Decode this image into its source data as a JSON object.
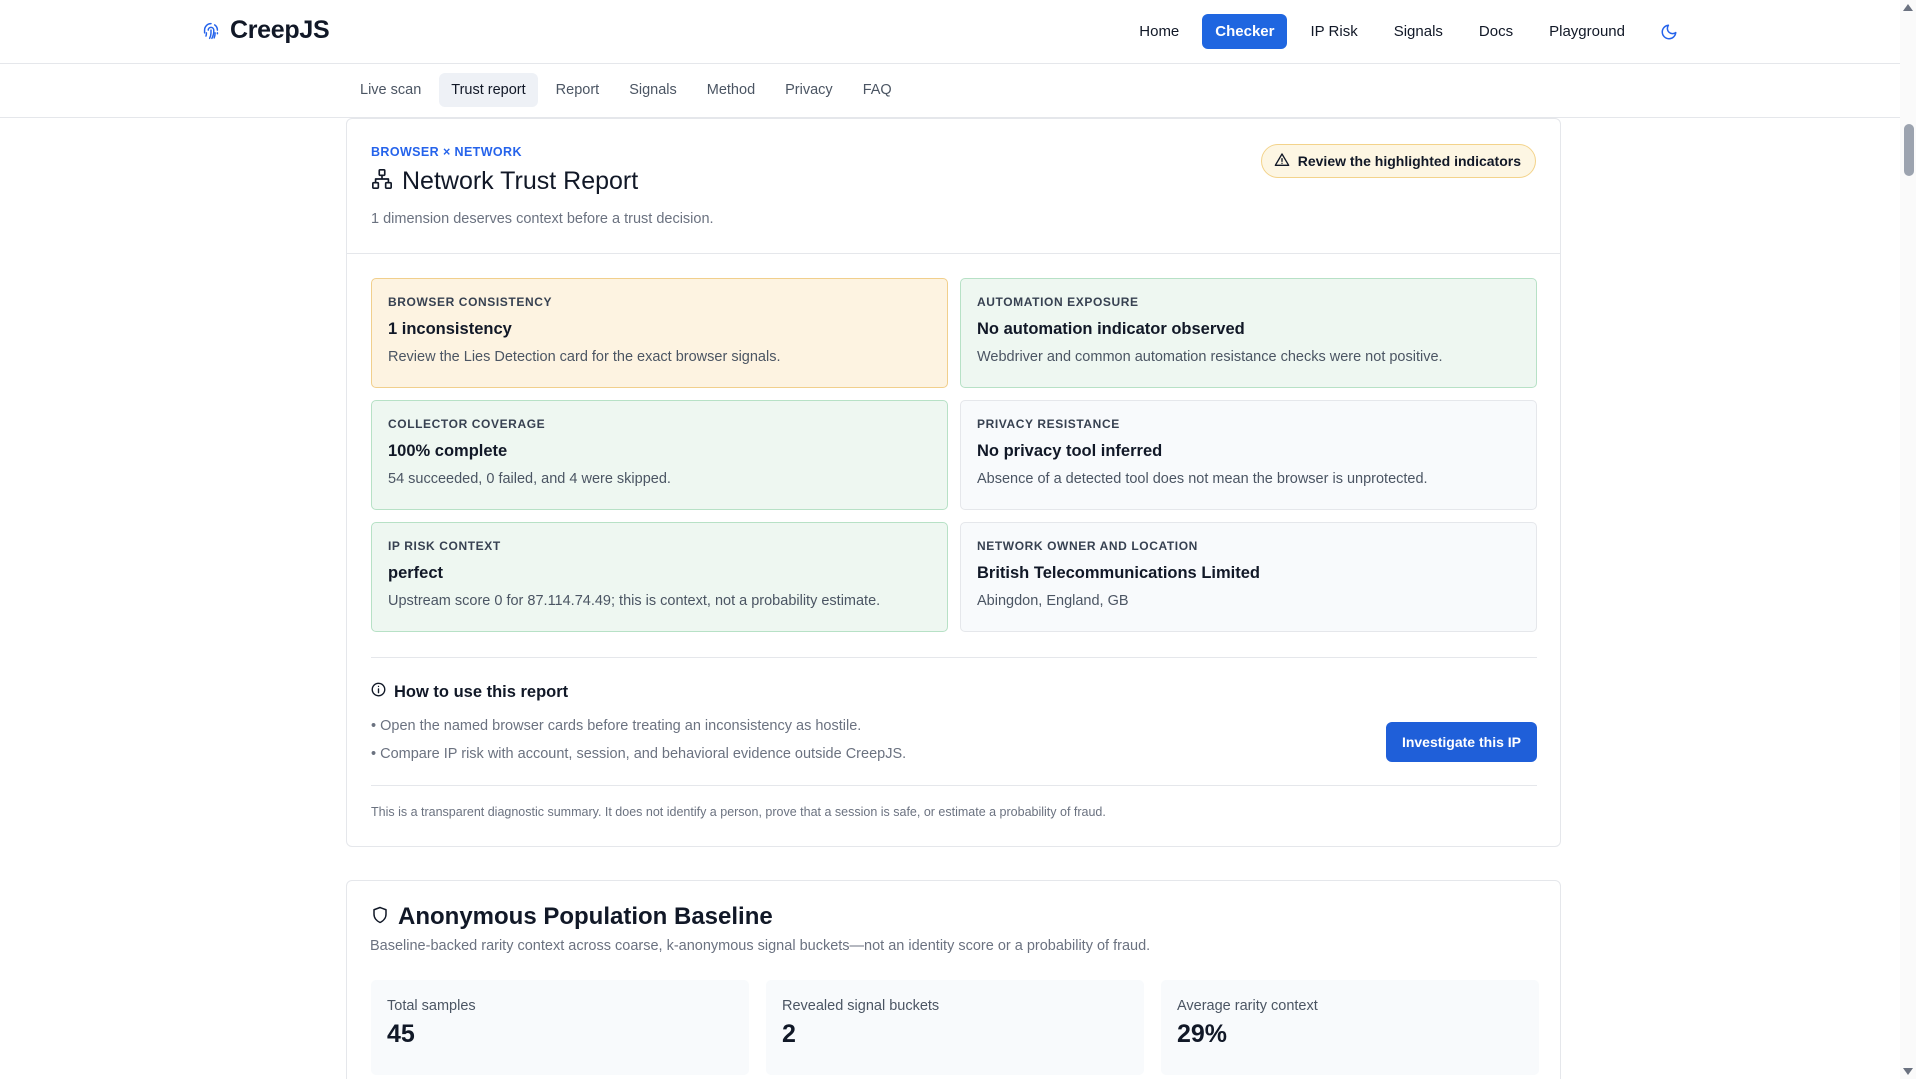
{
  "app": {
    "name": "CreepJS",
    "logo_icon": "fingerprint-icon"
  },
  "nav": {
    "items": [
      {
        "label": "Home"
      },
      {
        "label": "Checker",
        "active": true
      },
      {
        "label": "IP Risk"
      },
      {
        "label": "Signals"
      },
      {
        "label": "Docs"
      },
      {
        "label": "Playground"
      }
    ],
    "theme_icon": "moon-icon"
  },
  "subtabs": [
    {
      "label": "Live scan"
    },
    {
      "label": "Trust report",
      "active": true
    },
    {
      "label": "Report"
    },
    {
      "label": "Signals"
    },
    {
      "label": "Method"
    },
    {
      "label": "Privacy"
    },
    {
      "label": "FAQ"
    }
  ],
  "report": {
    "eyebrow": "BROWSER × NETWORK",
    "title": "Network Trust Report",
    "title_icon": "network-icon",
    "subtitle": "1 dimension deserves context before a trust decision.",
    "badge": "Review the highlighted indicators",
    "badge_icon": "warning-triangle-icon",
    "tiles": [
      {
        "label": "BROWSER CONSISTENCY",
        "value": "1 inconsistency",
        "desc": "Review the Lies Detection card for the exact browser signals.",
        "tone": "warn"
      },
      {
        "label": "AUTOMATION EXPOSURE",
        "value": "No automation indicator observed",
        "desc": "Webdriver and common automation resistance checks were not positive.",
        "tone": "ok"
      },
      {
        "label": "COLLECTOR COVERAGE",
        "value": "100% complete",
        "desc": "54 succeeded, 0 failed, and 4 were skipped.",
        "tone": "ok"
      },
      {
        "label": "PRIVACY RESISTANCE",
        "value": "No privacy tool inferred",
        "desc": "Absence of a detected tool does not mean the browser is unprotected.",
        "tone": "neutral"
      },
      {
        "label": "IP RISK CONTEXT",
        "value": "perfect",
        "desc": "Upstream score 0 for 87.114.74.49; this is context, not a probability estimate.",
        "tone": "ok"
      },
      {
        "label": "NETWORK OWNER AND LOCATION",
        "value": "British Telecommunications Limited",
        "desc": "Abingdon, England, GB",
        "tone": "neutral"
      }
    ],
    "howto": {
      "title": "How to use this report",
      "icon": "info-icon",
      "items": [
        "• Open the named browser cards before treating an inconsistency as hostile.",
        "• Compare IP risk with account, session, and behavioral evidence outside CreepJS."
      ],
      "button": "Investigate this IP"
    },
    "disclaimer": "This is a transparent diagnostic summary. It does not identify a person, prove that a session is safe, or estimate a probability of fraud."
  },
  "baseline": {
    "title": "Anonymous Population Baseline",
    "icon": "shield-icon",
    "subtitle": "Baseline-backed rarity context across coarse, k-anonymous signal buckets—not an identity score or a probability of fraud.",
    "stats": [
      {
        "label": "Total samples",
        "value": "45"
      },
      {
        "label": "Revealed signal buckets",
        "value": "2"
      },
      {
        "label": "Average rarity context",
        "value": "29%"
      }
    ]
  },
  "colors": {
    "accent": "#1f66e0",
    "eyebrow": "#2563eb",
    "warn_bg": "#fdf3e1",
    "ok_bg": "#eef7f1"
  }
}
